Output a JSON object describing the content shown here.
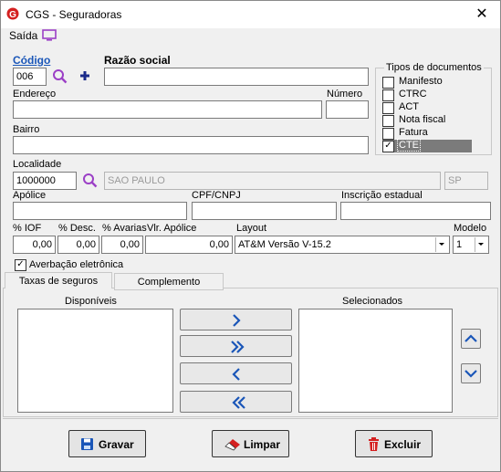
{
  "window": {
    "title": "CGS - Seguradoras",
    "close_glyph": "✕"
  },
  "menu": {
    "saida": "Saída"
  },
  "form": {
    "codigo_label": "Código",
    "codigo_value": "006",
    "razao_label": "Razão social",
    "razao_value": "",
    "endereco_label": "Endereço",
    "endereco_value": "",
    "numero_label": "Número",
    "numero_value": "",
    "bairro_label": "Bairro",
    "bairro_value": "",
    "localidade_label": "Localidade",
    "localidade_code": "1000000",
    "localidade_city": "SAO PAULO",
    "localidade_uf": "SP",
    "apolice_label": "Apólice",
    "cpf_label": "CPF/CNPJ",
    "ie_label": "Inscrição estadual",
    "iof_label": "% IOF",
    "iof_value": "0,00",
    "desc_label": "% Desc.",
    "desc_value": "0,00",
    "avarias_label": "% Avarias",
    "avarias_value": "0,00",
    "vlr_apolice_label": "Vlr. Apólice",
    "vlr_apolice_value": "0,00",
    "layout_label": "Layout",
    "layout_value": "AT&M Versão V-15.2",
    "modelo_label": "Modelo",
    "modelo_value": "1",
    "averbacao_label": "Averbação eletrônica",
    "averbacao_checked": true
  },
  "tipos": {
    "title": "Tipos de documentos",
    "items": [
      {
        "label": "Manifesto",
        "checked": false
      },
      {
        "label": "CTRC",
        "checked": false
      },
      {
        "label": "ACT",
        "checked": false
      },
      {
        "label": "Nota fiscal",
        "checked": false
      },
      {
        "label": "Fatura",
        "checked": false
      },
      {
        "label": "CTE",
        "checked": true
      }
    ]
  },
  "tabs": [
    {
      "label": "Taxas de seguros"
    },
    {
      "label": "Complemento"
    }
  ],
  "lists": {
    "disponiveis": "Disponíveis",
    "selecionados": "Selecionados"
  },
  "buttons": {
    "gravar": "Gravar",
    "limpar": "Limpar",
    "excluir": "Excluir"
  },
  "colors": {
    "accent_blue": "#1a56b8",
    "search_purple": "#9b3fc6",
    "delete_red": "#d42020"
  }
}
